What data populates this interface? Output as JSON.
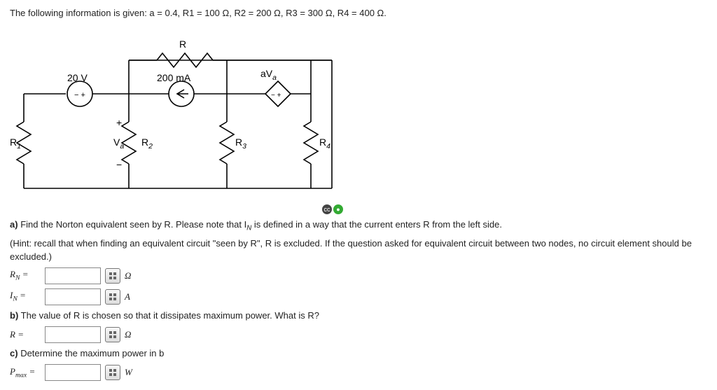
{
  "given": "The following information is given: a = 0.4, R1 = 100 Ω, R2 = 200 Ω, R3 = 300 Ω, R4 = 400 Ω.",
  "circuit": {
    "R_label": "R",
    "v_source": "20 V",
    "i_source": "200 mA",
    "dep_source": "aV",
    "dep_sub": "a",
    "va_plus": "+",
    "va_minus": "−",
    "va_label": "V",
    "va_label_sub": "a",
    "R1": "R",
    "R1_sub": "1",
    "R2": "R",
    "R2_sub": "2",
    "R3": "R",
    "R3_sub": "3",
    "R4": "R",
    "R4_sub": "4"
  },
  "part_a": {
    "text": "Find the Norton equivalent seen by R. Please note that I",
    "text_sub": "N",
    "text2": " is defined in a way that the current enters R from the left side.",
    "hint": "(Hint: recall that when finding an equivalent circuit \"seen by R\", R is excluded. If the question asked for equivalent circuit between two nodes, no circuit element should be excluded.)",
    "rn_label": "R",
    "rn_sub": "N",
    "rn_unit": "Ω",
    "in_label": "I",
    "in_sub": "N",
    "in_unit": "A"
  },
  "part_b": {
    "text": "The value of R is chosen so that it dissipates maximum power. What is R?",
    "r_label": "R",
    "r_unit": "Ω"
  },
  "part_c": {
    "text": "Determine the maximum power in b",
    "p_label": "P",
    "p_sub": "max",
    "p_unit": "W"
  },
  "labels": {
    "a": "a)",
    "b": "b)",
    "c": "c)",
    "eq": " = "
  },
  "answers": {
    "rn": "",
    "in": "",
    "r": "",
    "pmax": ""
  }
}
